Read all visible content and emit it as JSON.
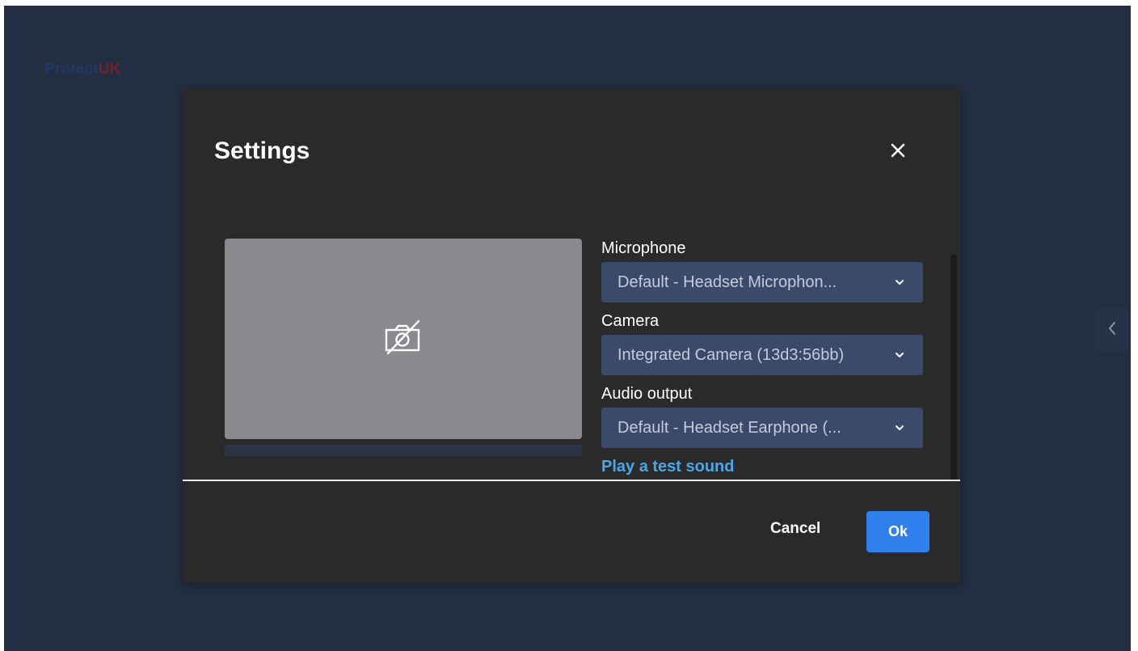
{
  "app": {
    "brand_part1": "Protect",
    "brand_part2": "UK",
    "background_color": "#232e42"
  },
  "dialog": {
    "title": "Settings",
    "close_icon": "close-icon",
    "preview": {
      "icon": "camera-off-icon"
    },
    "fields": [
      {
        "label": "Microphone",
        "value": "Default - Headset Microphon..."
      },
      {
        "label": "Camera",
        "value": "Integrated Camera (13d3:56bb)"
      },
      {
        "label": "Audio output",
        "value": "Default - Headset Earphone (..."
      }
    ],
    "test_sound_label": "Play a test sound",
    "cancel_label": "Cancel",
    "ok_label": "Ok",
    "colors": {
      "dialog_bg": "#2a2a2a",
      "select_bg": "#3b4a6b",
      "link": "#4aa6e6",
      "primary": "#2f80ed"
    }
  },
  "sidebar_toggle_icon": "chevron-left-icon"
}
